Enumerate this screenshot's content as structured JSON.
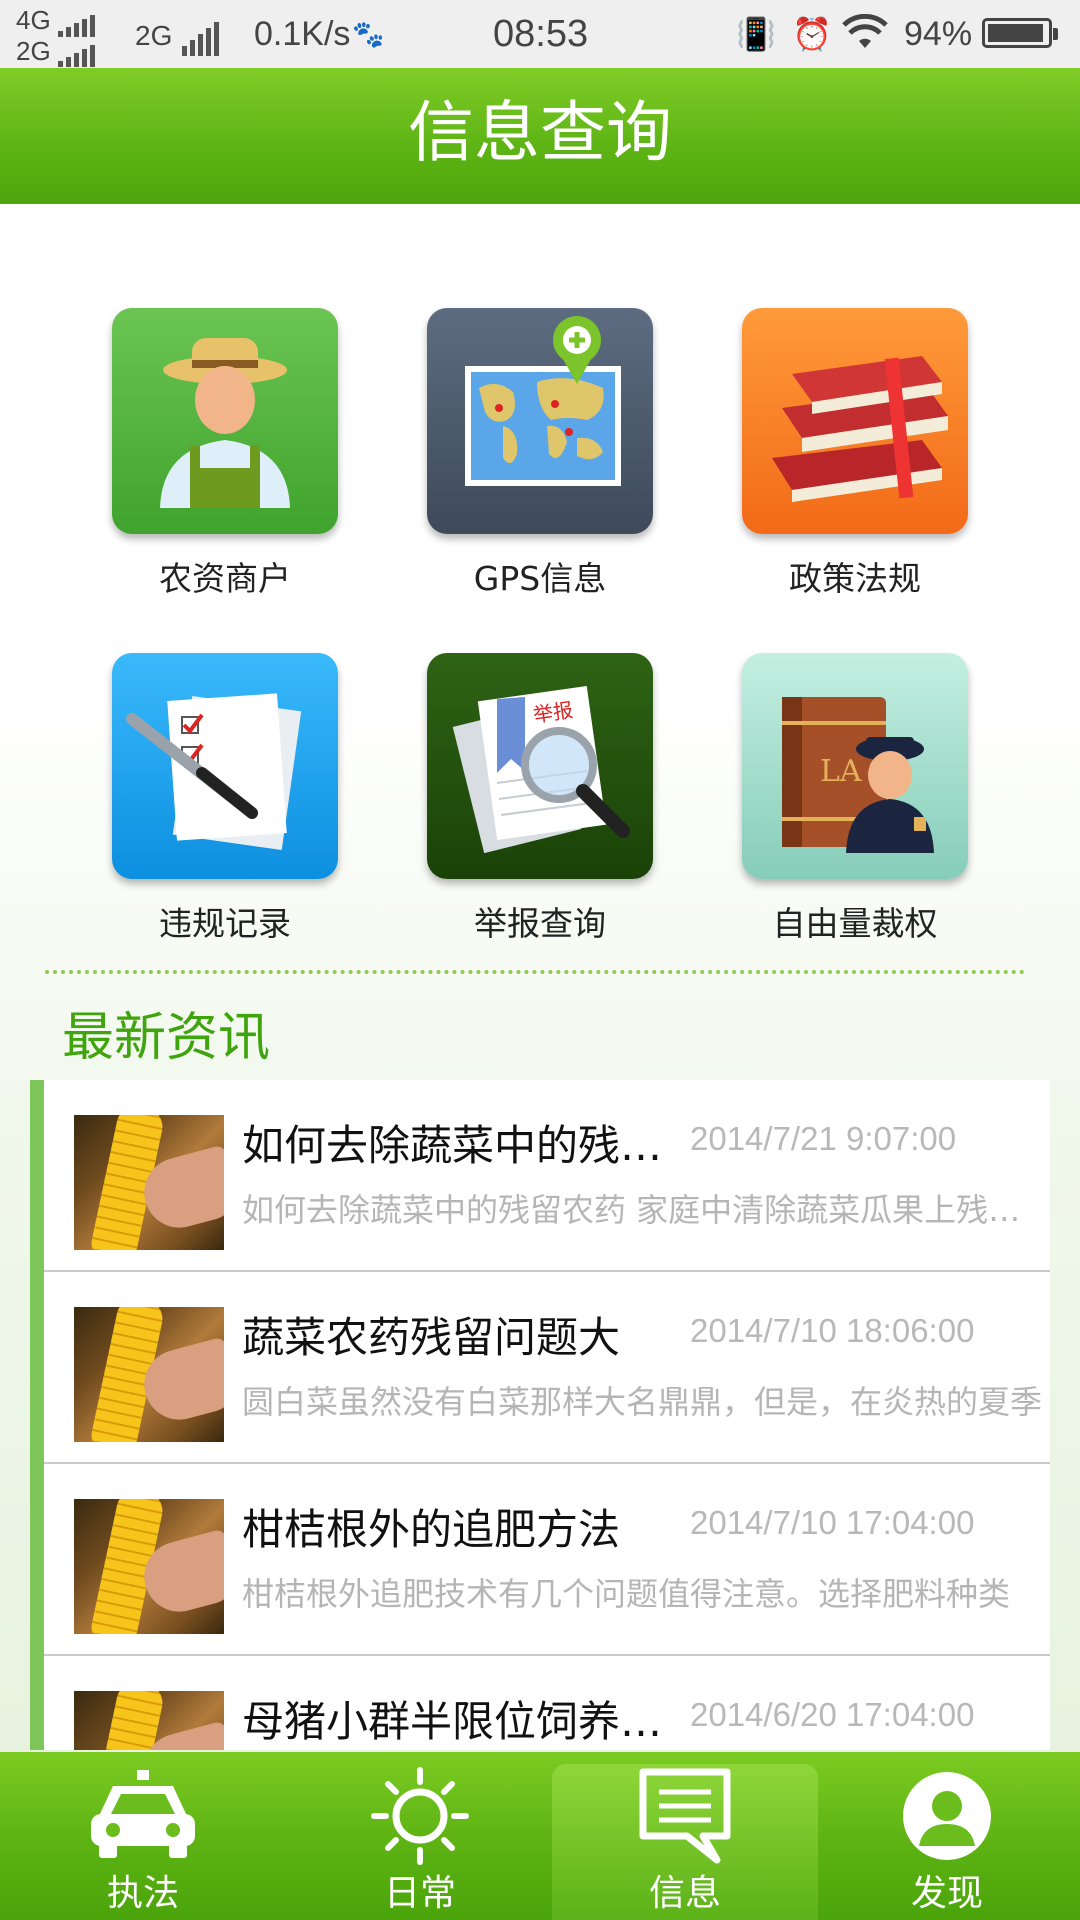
{
  "status_bar": {
    "network_top": "4G",
    "network_bottom": "2G",
    "network_2": "2G",
    "speed": "0.1K/s",
    "time": "08:53",
    "battery": "94%"
  },
  "header": {
    "title": "信息查询"
  },
  "grid": [
    {
      "label": "农资商户",
      "icon": "farmer-icon",
      "color": "#4fb33b"
    },
    {
      "label": "GPS信息",
      "icon": "map-pin-icon",
      "color": "#4f5e72"
    },
    {
      "label": "政策法规",
      "icon": "books-icon",
      "color": "#f07a28"
    },
    {
      "label": "违规记录",
      "icon": "checklist-pen-icon",
      "color": "#1aa6ec"
    },
    {
      "label": "举报查询",
      "icon": "report-magnifier-icon",
      "color": "#234f0c"
    },
    {
      "label": "自由量裁权",
      "icon": "law-officer-icon",
      "color": "#9edbc9"
    }
  ],
  "news_section": {
    "title": "最新资讯"
  },
  "news": [
    {
      "title": "如何去除蔬菜中的残留农药",
      "date": "2014/7/21 9:07:00",
      "summary": "如何去除蔬菜中的残留农药 家庭中清除蔬菜瓜果上残留农药的方法"
    },
    {
      "title": "蔬菜农药残留问题大",
      "date": "2014/7/10 18:06:00",
      "summary": "圆白菜虽然没有白菜那样大名鼎鼎，但是，在炎热的夏季"
    },
    {
      "title": "柑桔根外的追肥方法",
      "date": "2014/7/10 17:04:00",
      "summary": "柑桔根外追肥技术有几个问题值得注意。选择肥料种类"
    },
    {
      "title": "母猪小群半限位饲养技术",
      "date": "2014/6/20 17:04:00",
      "summary": ""
    }
  ],
  "bottom_nav": [
    {
      "label": "执法",
      "icon": "police-car-icon",
      "active": false
    },
    {
      "label": "日常",
      "icon": "sun-icon",
      "active": false
    },
    {
      "label": "信息",
      "icon": "message-icon",
      "active": true
    },
    {
      "label": "发现",
      "icon": "profile-icon",
      "active": false
    }
  ]
}
